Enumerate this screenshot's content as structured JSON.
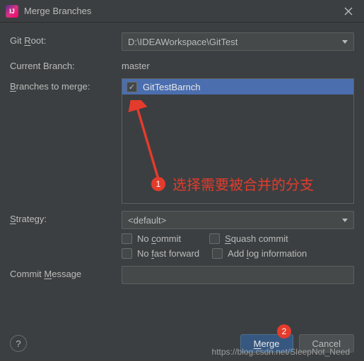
{
  "window": {
    "title": "Merge Branches"
  },
  "labels": {
    "git_root_pre": "Git ",
    "git_root_u": "R",
    "git_root_post": "oot:",
    "current_branch": "Current Branch:",
    "branches_u": "B",
    "branches_post": "ranches to merge:",
    "strategy_u": "S",
    "strategy_post": "trategy:",
    "commit_pre": "Commit ",
    "commit_u": "M",
    "commit_post": "essage"
  },
  "fields": {
    "git_root_value": "D:\\IDEAWorkspace\\GitTest",
    "current_branch_value": "master",
    "strategy_value": "<default>",
    "commit_message": ""
  },
  "branches": [
    {
      "label": "GitTestBarnch",
      "checked": true
    }
  ],
  "options": {
    "no_commit_pre": "No ",
    "no_commit_u": "c",
    "no_commit_post": "ommit",
    "squash_u": "S",
    "squash_post": "quash commit",
    "no_ff_pre": "No ",
    "no_ff_u": "f",
    "no_ff_post": "ast forward",
    "add_log_pre": "Add ",
    "add_log_u": "l",
    "add_log_post": "og information"
  },
  "buttons": {
    "merge_u": "M",
    "merge_post": "erge",
    "cancel": "Cancel",
    "help": "?"
  },
  "annotations": {
    "badge1": "1",
    "badge2": "2",
    "text1": "选择需要被合并的分支"
  },
  "watermark": "https://blog.csdn.net/SleepNot_Need"
}
